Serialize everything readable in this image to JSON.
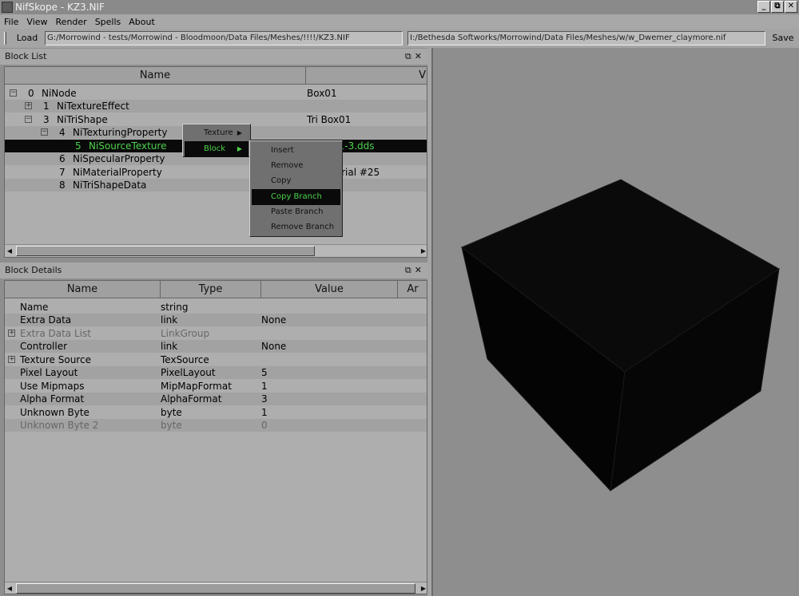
{
  "window": {
    "title": "NifSkope - KZ3.NIF"
  },
  "menu": [
    "File",
    "View",
    "Render",
    "Spells",
    "About"
  ],
  "toolbar": {
    "load_label": "Load",
    "load_path": "G:/Morrowind - tests/Morrowind - Bloodmoon/Data Files/Meshes/!!!!/KZ3.NIF",
    "save_path": "I:/Bethesda Softworks/Morrowind/Data Files/Meshes/w/w_Dwemer_claymore.nif",
    "save_label": "Save"
  },
  "block_list": {
    "title": "Block List",
    "dock_buttons": "⧉✕",
    "columns": [
      "Name",
      "V"
    ],
    "rows": [
      {
        "index": "0",
        "name": "NiNode",
        "value": "Box01",
        "expander": "−"
      },
      {
        "index": "1",
        "name": "NiTextureEffect",
        "value": "",
        "expander": "+"
      },
      {
        "index": "3",
        "name": "NiTriShape",
        "value": "Tri Box01",
        "expander": "−"
      },
      {
        "index": "4",
        "name": "NiTexturingProperty",
        "value": "",
        "expander": "−"
      },
      {
        "index": "5",
        "name": "NiSourceTexture",
        "value": "01-3.dds",
        "expander": ""
      },
      {
        "index": "6",
        "name": "NiSpecularProperty",
        "value": "",
        "expander": ""
      },
      {
        "index": "7",
        "name": "NiMaterialProperty",
        "value": "terial #25",
        "expander": ""
      },
      {
        "index": "8",
        "name": "NiTriShapeData",
        "value": "",
        "expander": ""
      }
    ]
  },
  "block_details": {
    "title": "Block Details",
    "dock_buttons": "⧉✕",
    "columns": [
      "Name",
      "Type",
      "Value",
      "Ar"
    ],
    "rows": [
      {
        "name": "Name",
        "type": "string",
        "value": ""
      },
      {
        "name": "Extra Data",
        "type": "link",
        "value": "None"
      },
      {
        "name": "Extra Data List",
        "type": "LinkGroup",
        "value": ""
      },
      {
        "name": "Controller",
        "type": "link",
        "value": "None"
      },
      {
        "name": "Texture Source",
        "type": "TexSource",
        "value": ""
      },
      {
        "name": "Pixel Layout",
        "type": "PixelLayout",
        "value": "5"
      },
      {
        "name": "Use Mipmaps",
        "type": "MipMapFormat",
        "value": "1"
      },
      {
        "name": "Alpha Format",
        "type": "AlphaFormat",
        "value": "3"
      },
      {
        "name": "Unknown Byte",
        "type": "byte",
        "value": "1"
      },
      {
        "name": "Unknown Byte 2",
        "type": "byte",
        "value": "0"
      }
    ]
  },
  "context_menu": {
    "items": [
      {
        "label": "Texture",
        "submenu": "▶"
      },
      {
        "label": "Block",
        "submenu": "▶"
      }
    ]
  },
  "block_submenu": {
    "items": [
      "Insert",
      "Remove",
      "Copy",
      "Copy Branch",
      "Paste Branch",
      "Remove Branch"
    ]
  },
  "colors": {
    "selection_bg": "#0a0a0a",
    "selection_text": "#4cd24c",
    "viewport_bg": "#8e8e8e",
    "cube": "#050505"
  }
}
